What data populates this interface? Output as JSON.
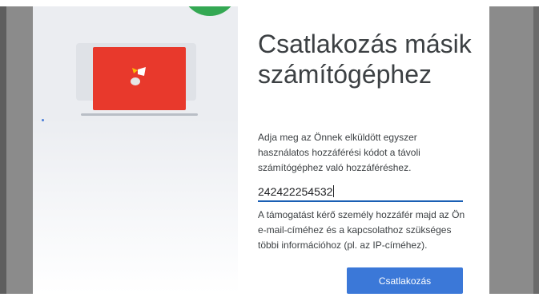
{
  "dialog": {
    "title": "Csatlakozás másik számítógéphez",
    "description": "Adja meg az Önnek elküldött egyszer használatos hozzáférési kódot a távoli számítógéphez való hozzáféréshez.",
    "access_code_value": "242422254532",
    "access_code_placeholder": "",
    "note": "A támogatást kérő személy hozzáfér majd az Ön e-mail-címéhez és a kapcsolathoz szükséges többi információhoz (pl. az IP-címéhez).",
    "connect_label": "Csatlakozás"
  },
  "icons": {
    "app": "chrome-remote-desktop-icon",
    "illustration": "laptop-icon"
  },
  "colors": {
    "accent": "#3b78d8",
    "input_underline": "#1a5fb4",
    "illustration_screen": "#e8392c",
    "illustration_blob": "#34a853",
    "backdrop": "#8b8b8b"
  }
}
